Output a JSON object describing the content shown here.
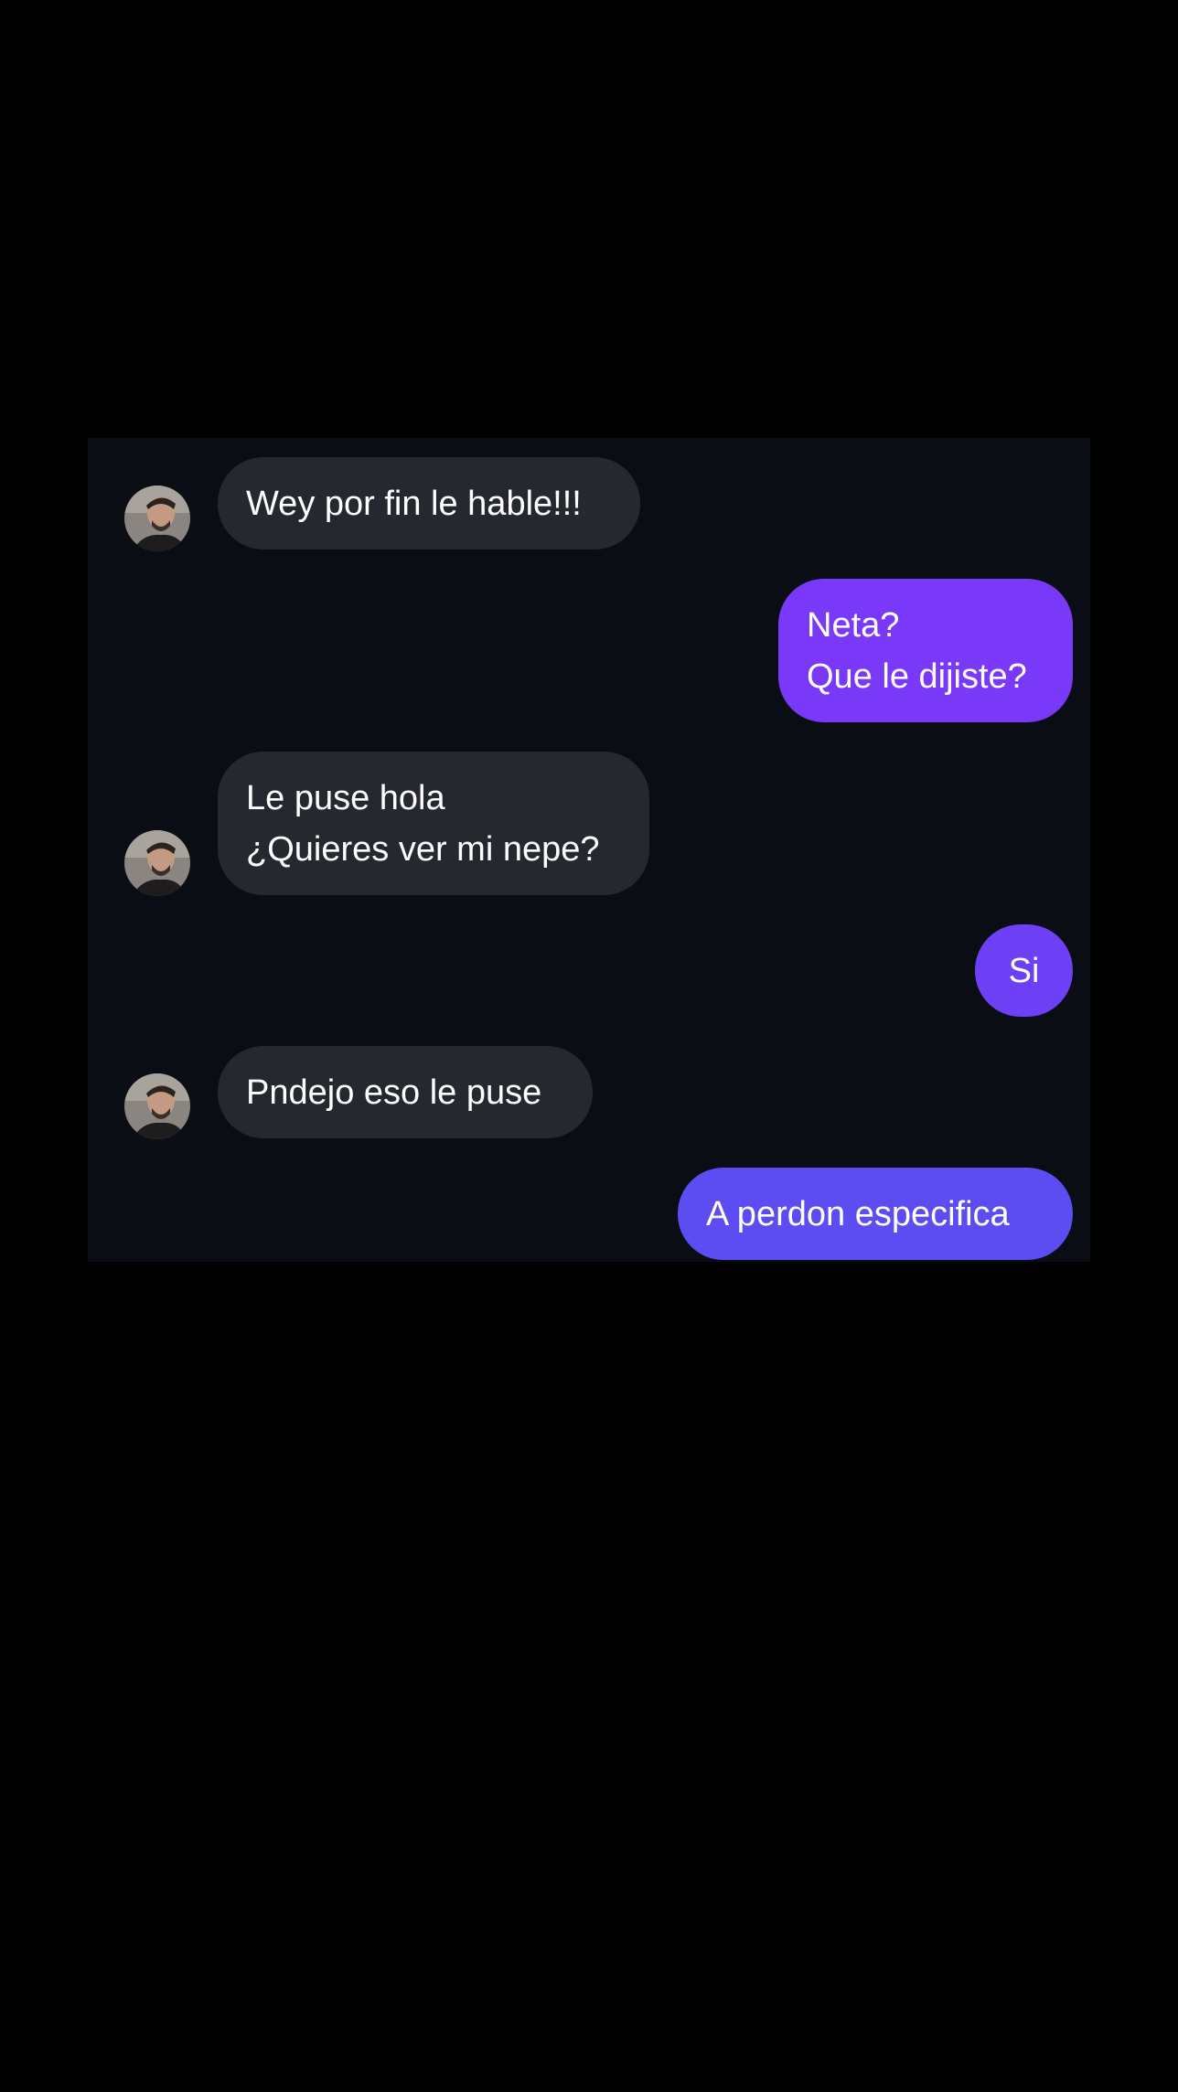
{
  "conversation": {
    "messages": [
      {
        "sender": "contact",
        "text": "Wey por fin le hable!!!"
      },
      {
        "sender": "me",
        "text": "Neta?\nQue le dijiste?"
      },
      {
        "sender": "contact",
        "text": "Le puse hola\n¿Quieres ver mi nepe?"
      },
      {
        "sender": "me",
        "text": "Si"
      },
      {
        "sender": "contact",
        "text": "Pndejo eso le puse"
      },
      {
        "sender": "me",
        "text": "A perdon especifica"
      }
    ]
  },
  "colors": {
    "background": "#000000",
    "chat_background": "#0b0d14",
    "incoming_bubble": "#26282f",
    "outgoing_bubble_top": "#7a38f8",
    "outgoing_bubble_bottom": "#5b4df1"
  },
  "icons": {
    "avatar": "contact-avatar-photo"
  }
}
